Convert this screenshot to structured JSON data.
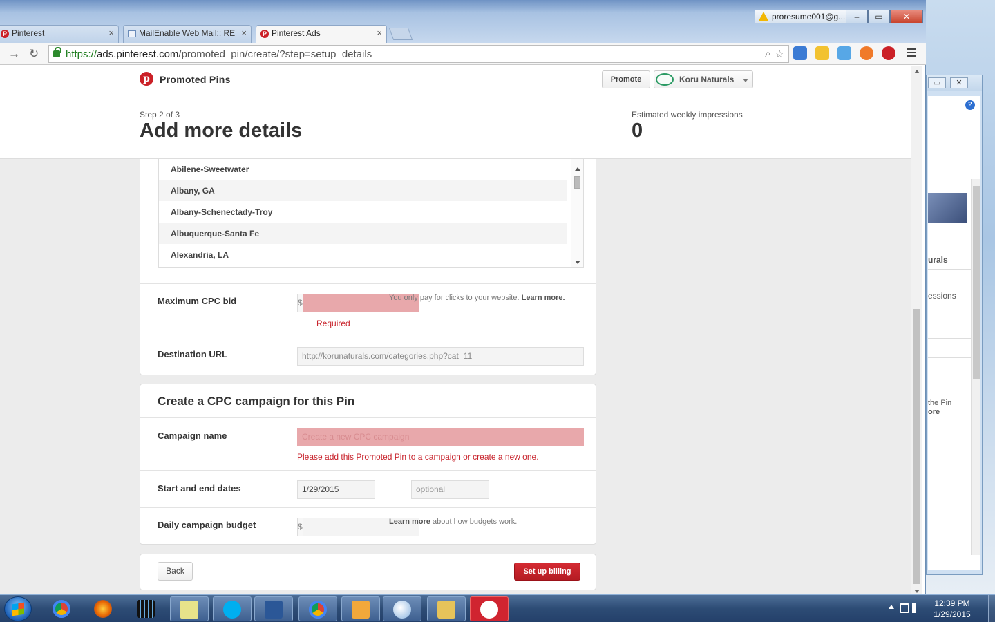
{
  "browser": {
    "tabs": [
      {
        "title": "Pinterest",
        "active": false
      },
      {
        "title": "MailEnable Web Mail:: RE",
        "active": false
      },
      {
        "title": "Pinterest Ads",
        "active": true
      }
    ],
    "profile": "proresume001@g...",
    "url": {
      "scheme": "https://",
      "host": "ads.pinterest.com",
      "path": "/promoted_pin/create/?step=setup_details"
    }
  },
  "header": {
    "brand": "Promoted Pins",
    "promote_label": "Promote",
    "account_name": "Koru Naturals"
  },
  "step": {
    "label": "Step 2 of 3",
    "title": "Add more details",
    "impressions_label": "Estimated weekly impressions",
    "impressions_value": "0"
  },
  "targeting": {
    "metros": [
      "Abilene-Sweetwater",
      "Albany, GA",
      "Albany-Schenectady-Troy",
      "Albuquerque-Santa Fe",
      "Alexandria, LA"
    ]
  },
  "cpc": {
    "label": "Maximum CPC bid",
    "currency": "$",
    "value": "",
    "error": "Required",
    "help": "You only pay for clicks to your website.",
    "help_link": "Learn more."
  },
  "destination": {
    "label": "Destination URL",
    "value": "http://korunaturals.com/categories.php?cat=11"
  },
  "campaign": {
    "title": "Create a CPC campaign for this Pin",
    "name_label": "Campaign name",
    "name_placeholder": "Create a new CPC campaign",
    "name_error": "Please add this Promoted Pin to a campaign or create a new one.",
    "dates_label": "Start and end dates",
    "start_date": "1/29/2015",
    "dash": "—",
    "end_placeholder": "optional",
    "budget_label": "Daily campaign budget",
    "budget_currency": "$",
    "budget_help_link": "Learn more",
    "budget_help": "about how budgets work."
  },
  "actions": {
    "back_label": "Back",
    "billing_label": "Set up billing"
  },
  "side_window": {
    "account_partial": "urals",
    "impressions_partial": "essions",
    "pin_partial": "the Pin",
    "more_partial": "ore"
  },
  "taskbar": {
    "time": "12:39 PM",
    "date": "1/29/2015"
  },
  "colors": {
    "pinterest_red": "#cb2027",
    "error_red": "#c8232c",
    "error_field": "#e8a8ab"
  }
}
